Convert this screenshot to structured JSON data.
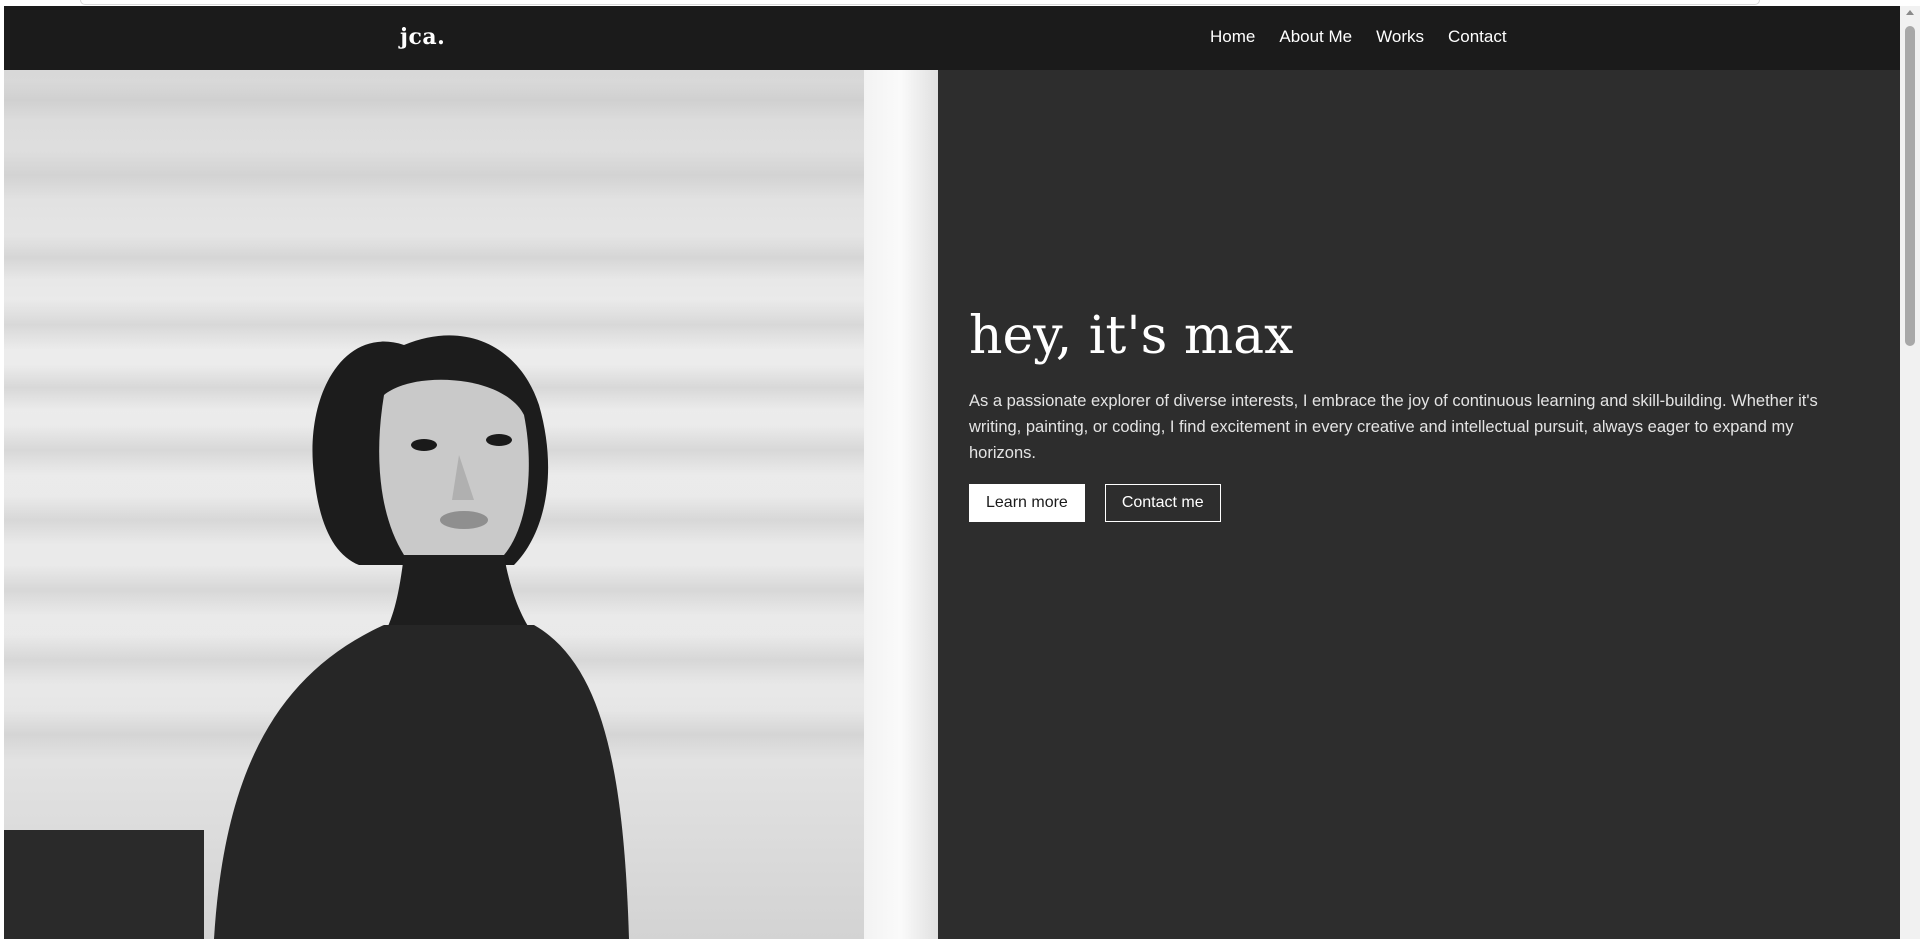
{
  "navbar": {
    "brand": "jca.",
    "links": [
      "Home",
      "About Me",
      "Works",
      "Contact"
    ]
  },
  "hero": {
    "title": "hey, it's max",
    "description": "As a passionate explorer of diverse interests, I embrace the joy of continuous learning and skill-building. Whether it's writing, painting, or coding, I find excitement in every creative and intellectual pursuit, always eager to expand my horizons.",
    "primary_button": "Learn more",
    "secondary_button": "Contact me",
    "photo_icon": "portrait-photo"
  },
  "colors": {
    "navbar_bg": "#1b1b1b",
    "hero_bg": "#2d2d2d",
    "text": "#ffffff"
  }
}
